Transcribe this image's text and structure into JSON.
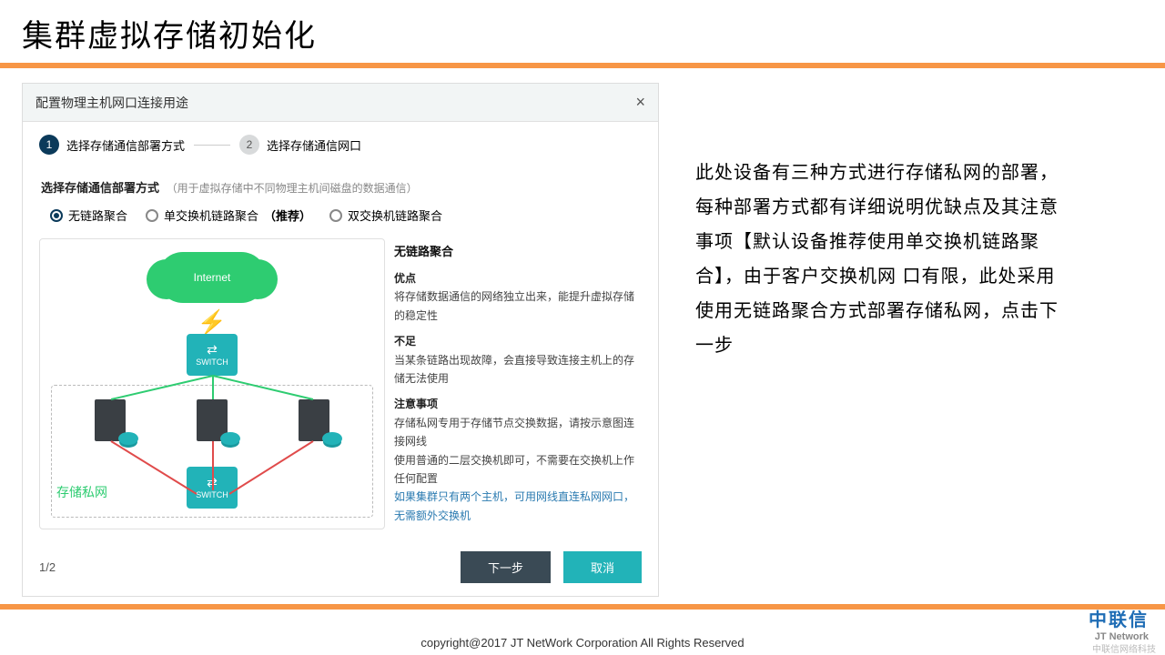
{
  "page": {
    "title": "集群虚拟存储初始化",
    "copyright": "copyright@2017  JT NetWork Corporation All Rights Reserved",
    "tiny_footer": "中联信网络科技"
  },
  "logo": {
    "cn": "中联信",
    "en": "JT Network"
  },
  "app": {
    "header_title": "配置物理主机网口连接用途",
    "steps": {
      "s1_num": "1",
      "s1_label": "选择存储通信部署方式",
      "s2_num": "2",
      "s2_label": "选择存储通信网口"
    },
    "section": {
      "title": "选择存储通信部署方式",
      "hint": "（用于虚拟存储中不同物理主机间磁盘的数据通信）"
    },
    "radios": {
      "r1": "无链路聚合",
      "r2": "单交换机链路聚合",
      "r2_rec": "（推荐）",
      "r3": "双交换机链路聚合"
    },
    "diagram": {
      "cloud": "Internet",
      "switch_label": "SWITCH",
      "private_net": "存储私网"
    },
    "desc": {
      "title": "无链路聚合",
      "pros_h": "优点",
      "pros_body": "将存储数据通信的网络独立出来，能提升虚拟存储的稳定性",
      "cons_h": "不足",
      "cons_body": "当某条链路出现故障，会直接导致连接主机上的存储无法使用",
      "note_h": "注意事项",
      "note_1": "存储私网专用于存储节点交换数据，请按示意图连接网线",
      "note_2": "使用普通的二层交换机即可，不需要在交换机上作任何配置",
      "link": "如果集群只有两个主机，可用网线直连私网网口，无需额外交换机"
    },
    "footer": {
      "pager": "1/2",
      "next": "下一步",
      "cancel": "取消"
    }
  },
  "explain": "此处设备有三种方式进行存储私网的部署，每种部署方式都有详细说明优缺点及其注意事项【默认设备推荐使用单交换机链路聚合】，由于客户交换机网 口有限，此处采用使用无链路聚合方式部署存储私网，点击下一步"
}
